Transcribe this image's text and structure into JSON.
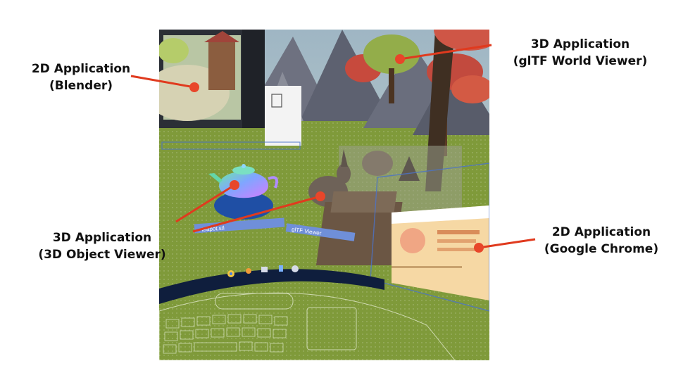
{
  "callouts": {
    "blender": {
      "line1": "2D Application",
      "line2": "(Blender)"
    },
    "gltf": {
      "line1": "3D Application",
      "line2": "(glTF World Viewer)"
    },
    "object_viewer": {
      "line1": "3D Application",
      "line2": "(3D Object Viewer)"
    },
    "chrome": {
      "line1": "2D Application",
      "line2": "(Google Chrome)"
    }
  },
  "labels": {
    "teapot_tag": "teapot.stl",
    "gltf_tag": "glTF Viewer"
  },
  "dock": {
    "icons": [
      "chrome-icon",
      "blender-icon",
      "window-icon",
      "document-icon",
      "settings-icon"
    ]
  },
  "colors": {
    "callout_line": "#e03a1e",
    "callout_dot": "#e8462a",
    "ground": "#7f9a3a",
    "dock": "#0f1e3d"
  }
}
